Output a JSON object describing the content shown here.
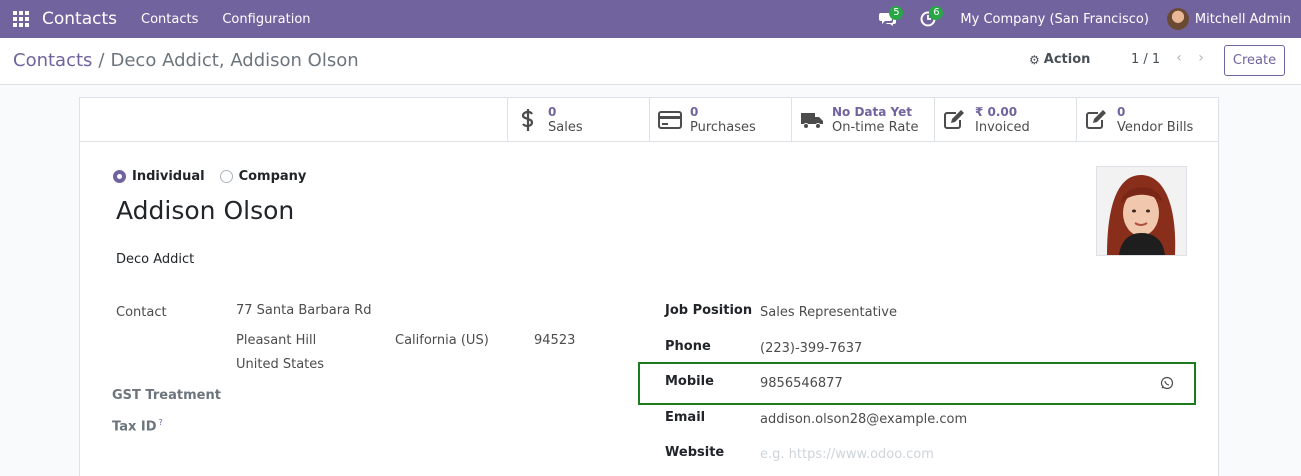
{
  "navbar": {
    "brand": "Contacts",
    "menu": [
      "Contacts",
      "Configuration"
    ],
    "messages_count": "5",
    "activities_count": "6",
    "company": "My Company (San Francisco)",
    "user": "Mitchell Admin",
    "accent_color": "#71639e",
    "badge_color": "#28a745"
  },
  "control_panel": {
    "breadcrumb_parent": "Contacts",
    "breadcrumb_separator": "/",
    "breadcrumb_current": "Deco Addict, Addison Olson",
    "action_label": "Action",
    "pager": "1 / 1",
    "create_label": "Create"
  },
  "stat_buttons": [
    {
      "icon": "dollar-icon",
      "value": "0",
      "label": "Sales"
    },
    {
      "icon": "credit-card-icon",
      "value": "0",
      "label": "Purchases"
    },
    {
      "icon": "truck-icon",
      "value": "No Data Yet",
      "label": "On-time Rate"
    },
    {
      "icon": "pencil-square-icon",
      "value": "₹ 0.00",
      "label": "Invoiced"
    },
    {
      "icon": "pencil-square-icon",
      "value": "0",
      "label": "Vendor Bills"
    }
  ],
  "form": {
    "type_options": [
      "Individual",
      "Company"
    ],
    "selected_type": "Individual",
    "name": "Addison Olson",
    "parent_company": "Deco Addict",
    "address_label": "Contact",
    "street": "77 Santa Barbara Rd",
    "city": "Pleasant Hill",
    "state": "California (US)",
    "zip": "94523",
    "country": "United States",
    "gst_label": "GST Treatment",
    "tax_id_label": "Tax ID",
    "tax_id_help": "?",
    "job_position_label": "Job Position",
    "job_position": "Sales Representative",
    "phone_label": "Phone",
    "phone": "(223)-399-7637",
    "mobile_label": "Mobile",
    "mobile": "9856546877",
    "email_label": "Email",
    "email": "addison.olson28@example.com",
    "website_label": "Website",
    "website_placeholder": "e.g. https://www.odoo.com",
    "highlight_color": "#1e7a1e"
  }
}
